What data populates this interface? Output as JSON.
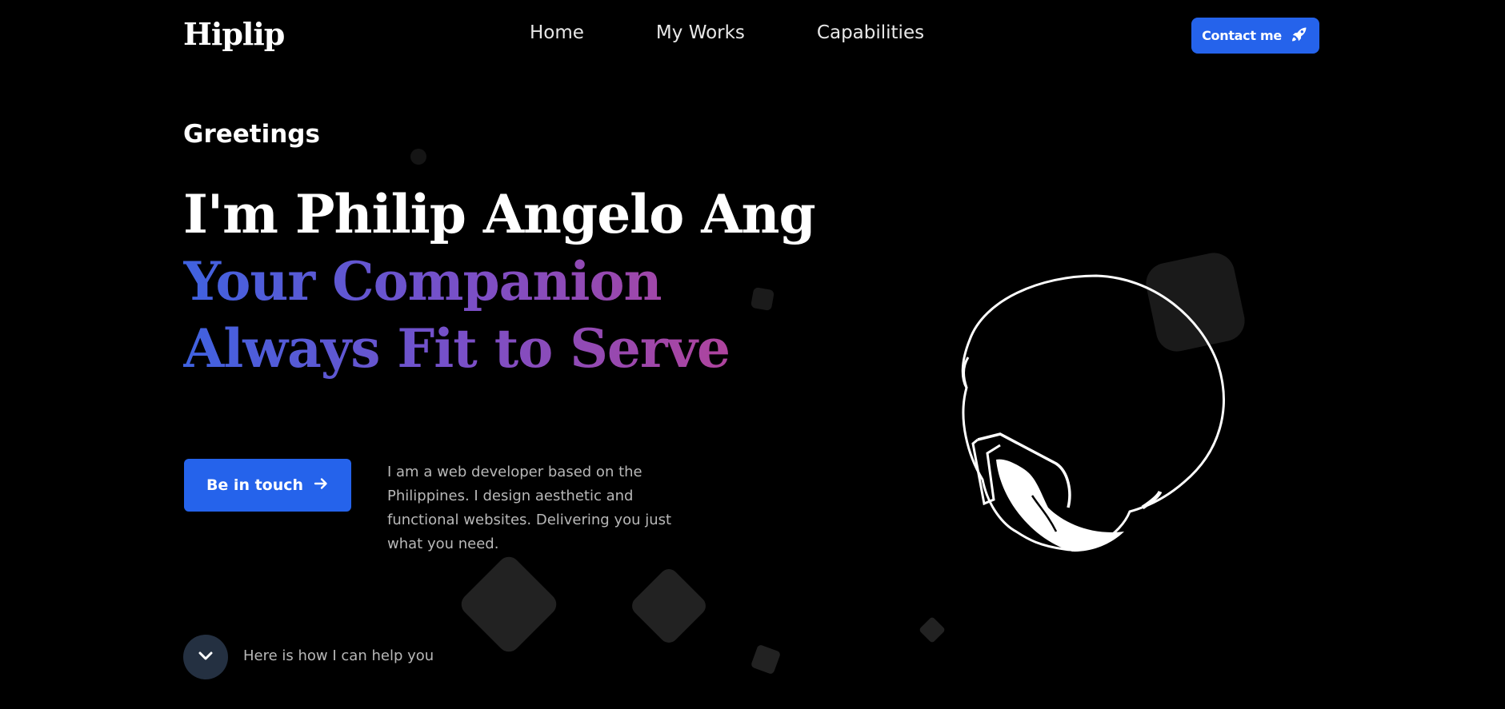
{
  "header": {
    "logo": "Hiplip",
    "nav": [
      "Home",
      "My Works",
      "Capabilities"
    ],
    "contact_label": "Contact me"
  },
  "hero": {
    "greeting": "Greetings",
    "headline_line1": "I'm Philip Angelo Ang",
    "headline_line2": "Your Companion",
    "headline_line3": "Always Fit to Serve",
    "cta_label": "Be in touch",
    "intro": "I am a web developer based on the Philippines. I design aesthetic and functional websites. Delivering you just what you need."
  },
  "scroll": {
    "label": "Here is how I can help you"
  },
  "colors": {
    "background": "#000000",
    "accent": "#2563eb",
    "gradient_start": "#3f62e0",
    "gradient_end": "#c0408f"
  },
  "icons": {
    "contact": "rocket-icon",
    "cta": "arrow-right-icon",
    "scroll": "chevron-down-icon"
  }
}
